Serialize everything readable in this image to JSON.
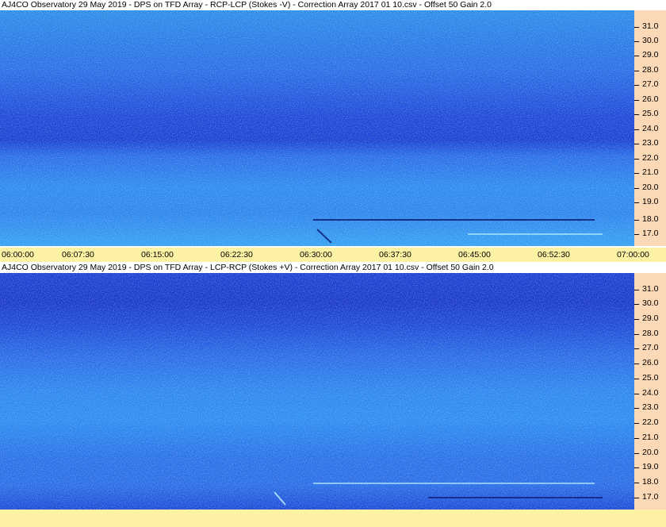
{
  "panels": [
    {
      "title": "AJ4CO Observatory 29 May 2019  -  DPS on TFD Array  -  RCP-LCP (Stokes -V)  -  Correction Array 2017 01 10.csv  -  Offset 50  Gain 2.0",
      "stokes": "RCP-LCP (Stokes -V)"
    },
    {
      "title": "AJ4CO Observatory 29 May 2019  -  DPS on TFD Array  -  LCP-RCP (Stokes +V)  -  Correction Array 2017 01 10.csv  -  Offset 50  Gain 2.0",
      "stokes": "LCP-RCP (Stokes +V)"
    }
  ],
  "freq_labels": [
    "31.0",
    "30.0",
    "29.0",
    "28.0",
    "27.0",
    "26.0",
    "25.0",
    "24.0",
    "23.0",
    "22.0",
    "21.0",
    "20.0",
    "19.0",
    "18.0",
    "17.0"
  ],
  "time_labels": [
    "06:00:00",
    "06:07:30",
    "06:15:00",
    "06:22:30",
    "06:30:00",
    "06:37:30",
    "06:45:00",
    "06:52:30",
    "07:00:00"
  ],
  "colors": {
    "spectrogram_base": "#2a5ef0",
    "freq_axis_bg": "#fbd8b6",
    "time_axis_bg": "#fdf2a4",
    "signal_highlight": "#b8ecff"
  }
}
